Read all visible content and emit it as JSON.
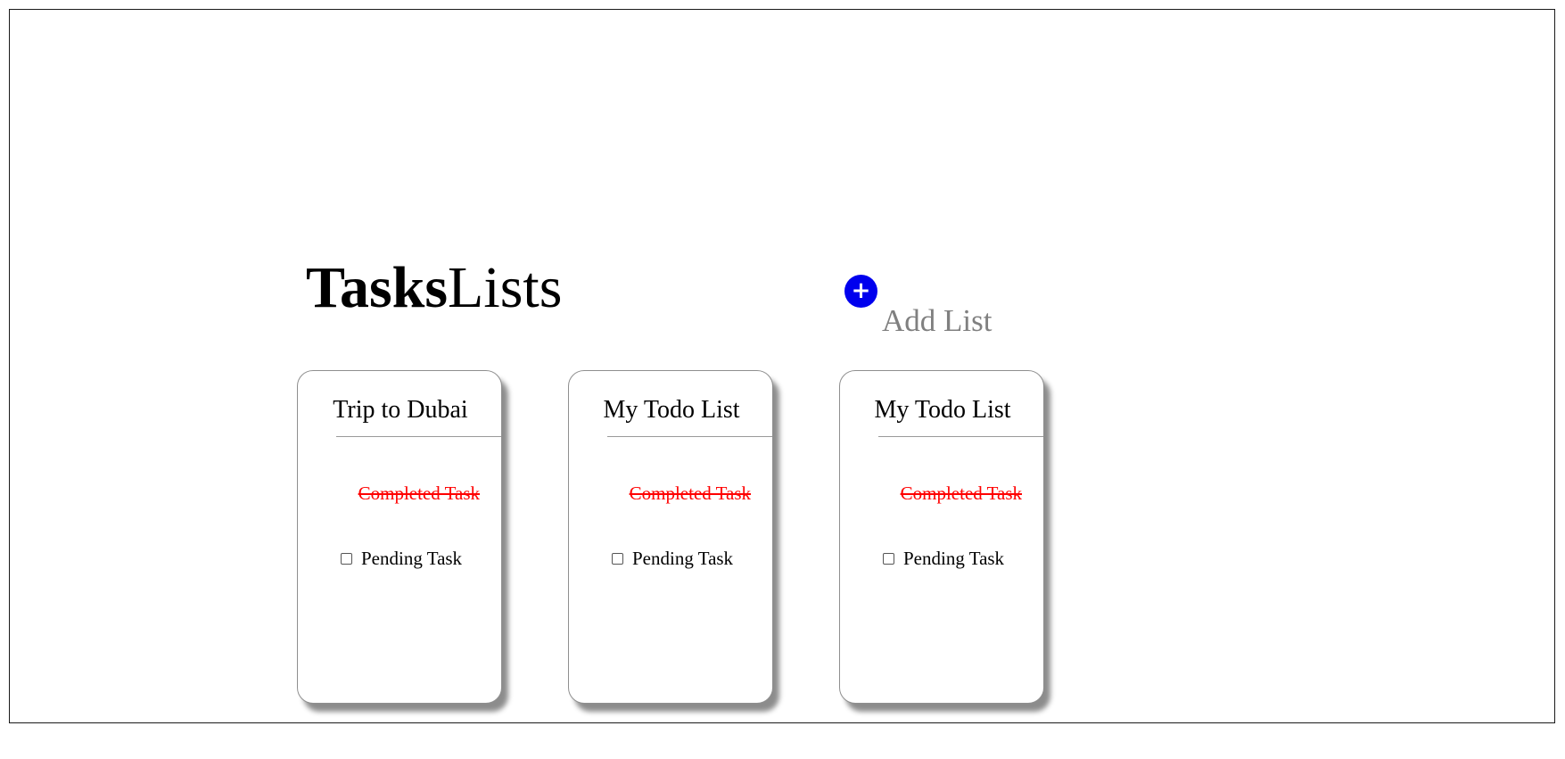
{
  "header": {
    "title_bold": "Tasks",
    "title_regular": "Lists",
    "add_icon": "plus-icon",
    "add_label": "Add List"
  },
  "lists": [
    {
      "title": "Trip to Dubai",
      "completed_task": "Completed Task",
      "pending_task": "Pending Task",
      "pending_checked": false
    },
    {
      "title": "My Todo List",
      "completed_task": "Completed Task",
      "pending_task": "Pending Task",
      "pending_checked": false
    },
    {
      "title": "My Todo List",
      "completed_task": "Completed Task",
      "pending_task": "Pending Task",
      "pending_checked": false
    }
  ],
  "colors": {
    "accent": "#0000ee",
    "completed_text": "#ff0000",
    "muted_text": "#808080"
  }
}
